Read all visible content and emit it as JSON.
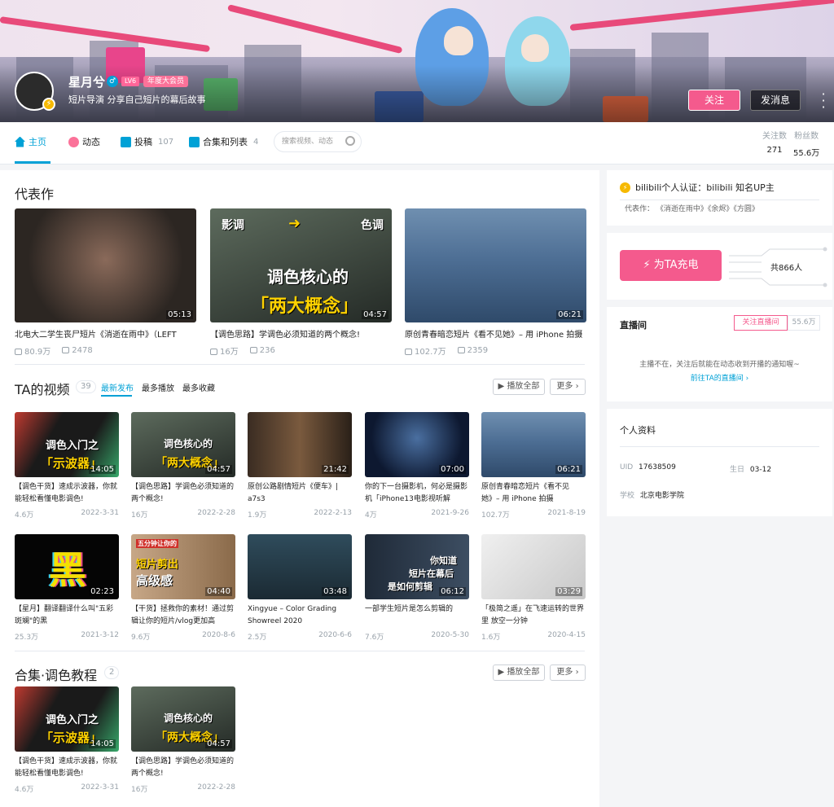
{
  "user": {
    "name": "星月兮",
    "level": "LV6",
    "vip_badge": "年度大会员",
    "sign": "短片导演 分享自己短片的幕后故事",
    "follow_label": "关注",
    "message_label": "发消息"
  },
  "nav": {
    "tabs": [
      {
        "label": "主页",
        "count": ""
      },
      {
        "label": "动态",
        "count": ""
      },
      {
        "label": "投稿",
        "count": "107"
      },
      {
        "label": "合集和列表",
        "count": "4"
      }
    ],
    "search_placeholder": "搜索视频、动态"
  },
  "stats": [
    {
      "label": "关注数",
      "value": "271"
    },
    {
      "label": "粉丝数",
      "value": "55.6万"
    }
  ],
  "masterpiece": {
    "title": "代表作",
    "items": [
      {
        "title": "北电大二学生丧尸短片《消逝在雨中》（LEFT",
        "duration": "05:13",
        "plays": "80.9万",
        "comments": "2478"
      },
      {
        "title": "【调色思路】学调色必须知道的两个概念!",
        "duration": "04:57",
        "plays": "16万",
        "comments": "236"
      },
      {
        "title": "原创青春暗恋短片《看不见她》– 用 iPhone 拍摄",
        "duration": "06:21",
        "plays": "102.7万",
        "comments": "2359"
      }
    ]
  },
  "videos": {
    "title": "TA的视频",
    "count": "39",
    "sort_tabs": [
      "最新发布",
      "最多播放",
      "最多收藏"
    ],
    "play_all": "播放全部",
    "more": "更多",
    "items": [
      {
        "title": "【调色干货】速成示波器，你就能轻松看懂电影调色!",
        "duration": "14:05",
        "plays": "4.6万",
        "date": "2022-3-31"
      },
      {
        "title": "【调色思路】学调色必须知道的两个概念!",
        "duration": "04:57",
        "plays": "16万",
        "date": "2022-2-28"
      },
      {
        "title": "原创公路剧情短片《便车》| a7s3",
        "duration": "21:42",
        "plays": "1.9万",
        "date": "2022-2-13"
      },
      {
        "title": "你的下一台摄影机，何必是摄影机「iPhone13电影视听解",
        "duration": "07:00",
        "plays": "4万",
        "date": "2021-9-26"
      },
      {
        "title": "原创青春暗恋短片《看不见她》– 用 iPhone 拍摄",
        "duration": "06:21",
        "plays": "102.7万",
        "date": "2021-8-19"
      },
      {
        "title": "【星月】翻译翻译什么叫\"五彩斑斓\"的黑",
        "duration": "02:23",
        "plays": "25.3万",
        "date": "2021-3-12"
      },
      {
        "title": "【干货】拯救你的素材！通过剪辑让你的短片/vlog更加高",
        "duration": "04:40",
        "plays": "9.6万",
        "date": "2020-8-6"
      },
      {
        "title": "Xingyue – Color Grading Showreel 2020",
        "duration": "03:48",
        "plays": "2.5万",
        "date": "2020-6-6"
      },
      {
        "title": "一部学生短片是怎么剪辑的",
        "duration": "06:12",
        "plays": "7.6万",
        "date": "2020-5-30"
      },
      {
        "title": "「极简之遥」在飞速运转的世界里 放空一分钟",
        "duration": "03:29",
        "plays": "1.6万",
        "date": "2020-4-15"
      }
    ]
  },
  "collection": {
    "title": "合集·调色教程",
    "count": "2",
    "play_all": "播放全部",
    "more": "更多",
    "items": [
      {
        "title": "【调色干货】速成示波器，你就能轻松看懂电影调色!",
        "duration": "14:05",
        "plays": "4.6万",
        "date": "2022-3-31"
      },
      {
        "title": "【调色思路】学调色必须知道的两个概念!",
        "duration": "04:57",
        "plays": "16万",
        "date": "2022-2-28"
      }
    ]
  },
  "thumb_texts": {
    "v1_line1": "调色入门之",
    "v1_line2": "「示波器」",
    "v2_line1": "调色核心的",
    "v2_line2": "「两大概念」",
    "v2_tag_left": "影调",
    "v2_tag_right": "色调",
    "v6": "黑",
    "v7_tag": "五分钟让你的",
    "v7_line1": "短片剪出",
    "v7_line2": "高级感",
    "v9_line1": "你知道",
    "v9_line2": "短片在幕后",
    "v9_line3": "是如何剪辑"
  },
  "sidebar": {
    "cert_text": "bilibili个人认证：bilibili 知名UP主",
    "rep_works_label": "代表作：",
    "rep_works": "《消逝在雨中》《余烬》《方圆》",
    "charge_label": "为TA充电",
    "charge_count": "共866人",
    "live_title": "直播间",
    "live_follow": "关注直播间",
    "live_fans": "55.6万",
    "live_msg": "主播不在，关注后就能在动态收到开播的通知喔~",
    "live_link": "前往TA的直播间",
    "profile_title": "个人资料",
    "uid_label": "UID",
    "uid": "17638509",
    "birthday_label": "生日",
    "birthday": "03-12",
    "school_label": "学校",
    "school": "北京电影学院"
  }
}
